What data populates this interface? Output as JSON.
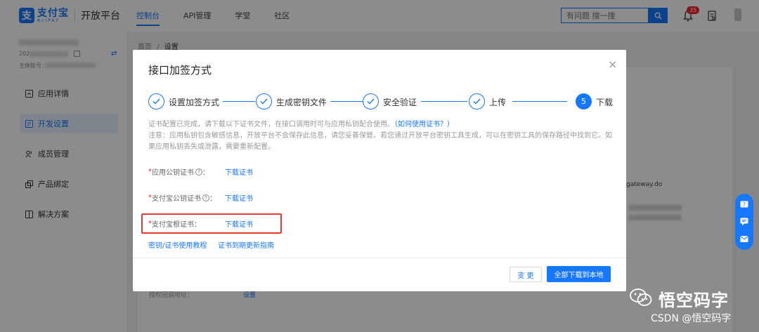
{
  "header": {
    "logo_cn": "支付宝",
    "logo_en": "ALIPAY",
    "platform_title": "开放平台",
    "nav": [
      {
        "label": "控制台",
        "active": true
      },
      {
        "label": "API管理",
        "active": false
      },
      {
        "label": "学堂",
        "active": false
      },
      {
        "label": "社区",
        "active": false
      }
    ],
    "search_placeholder": "有问题 搜一搜",
    "notification_count": "35"
  },
  "sidebar": {
    "account_prefix": "202",
    "account_subject_label": "主体账号：",
    "menu": [
      {
        "label": "应用详情",
        "icon": "app-detail-icon",
        "active": false
      },
      {
        "label": "开发设置",
        "icon": "dev-settings-icon",
        "active": true
      },
      {
        "label": "成员管理",
        "icon": "members-icon",
        "active": false
      },
      {
        "label": "产品绑定",
        "icon": "product-bind-icon",
        "active": false
      },
      {
        "label": "解决方案",
        "icon": "solution-icon",
        "active": false
      }
    ]
  },
  "breadcrumb": {
    "home": "首页",
    "sep": "/",
    "current": "设置"
  },
  "background": {
    "gateway_text": "gateway.do",
    "bottom_label": "授权回调地址：",
    "bottom_link": "设置"
  },
  "modal": {
    "title": "接口加签方式",
    "close": "×",
    "steps": [
      {
        "label": "设置加签方式",
        "status": "done"
      },
      {
        "label": "生成密钥文件",
        "status": "done"
      },
      {
        "label": "安全验证",
        "status": "done"
      },
      {
        "label": "上传",
        "status": "done"
      },
      {
        "label": "下载",
        "status": "current",
        "number": "5"
      }
    ],
    "desc_line1": "证书配置已完成，请下载以下证书文件，在接口调用时可与应用私钥配合使用。",
    "desc_link": "（如何使用证书？）",
    "desc_line2": "注意：应用私钥包含敏感信息，开放平台不会保存此信息，请您妥善保管。若您通过开放平台密钥工具生成，可以在密钥工具的保存路径中找到它。如果应用私钥丢失或泄露，需要重新配置。",
    "fields": [
      {
        "label": "应用公钥证书",
        "help": true,
        "link": "下载证书"
      },
      {
        "label": "支付宝公钥证书",
        "help": true,
        "link": "下载证书"
      },
      {
        "label": "支付宝根证书：",
        "help": false,
        "link": "下载证书"
      }
    ],
    "field_colon": "：",
    "help_symbol": "?",
    "required_mark": "*",
    "foot_links": [
      "密钥/证书使用教程",
      "证书到期更新指南"
    ],
    "btn_change": "变 更",
    "btn_download_all": "全部下载到本地"
  },
  "watermark": {
    "text": "悟空码字",
    "csdn": "CSDN @悟空码字"
  },
  "colors": {
    "primary": "#1677ff",
    "required": "#f5222d",
    "highlight_box": "#e53935"
  }
}
